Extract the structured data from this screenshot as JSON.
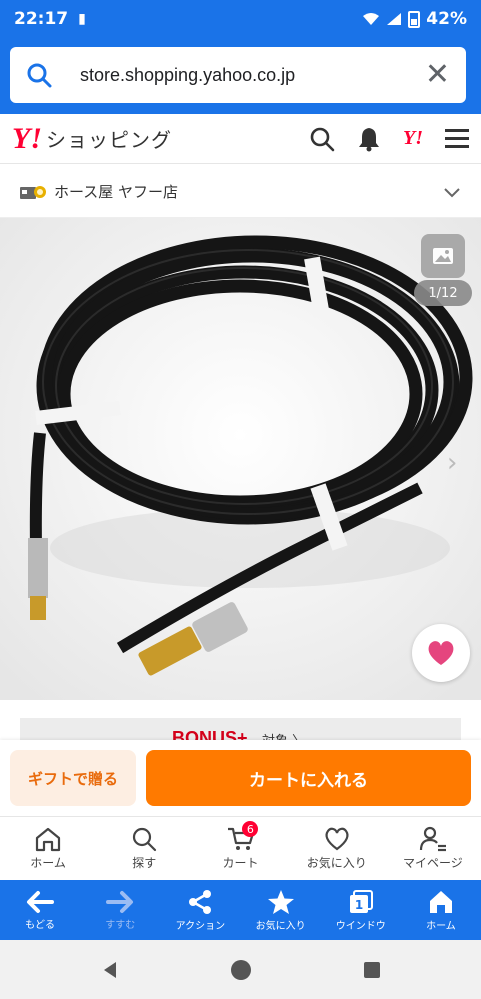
{
  "status": {
    "time": "22:17",
    "battery": "42%"
  },
  "url": {
    "text": "store.shopping.yahoo.co.jp"
  },
  "header": {
    "logo_mark": "Y!",
    "logo_text": "ショッピング",
    "yj_mark": "Y!"
  },
  "store": {
    "name": "ホース屋 ヤフー店"
  },
  "gallery": {
    "counter": "1/12"
  },
  "bonus": {
    "title": "BONUS+",
    "subtitle": "対象 〉"
  },
  "cta": {
    "gift_label": "ギフトで贈る",
    "cart_label": "カートに入れる"
  },
  "tabs": [
    {
      "label": "ホーム",
      "icon": "home-icon"
    },
    {
      "label": "探す",
      "icon": "search-icon"
    },
    {
      "label": "カート",
      "icon": "cart-icon",
      "badge": "6"
    },
    {
      "label": "お気に入り",
      "icon": "heart-icon"
    },
    {
      "label": "マイページ",
      "icon": "person-icon"
    }
  ],
  "browser": [
    {
      "label": "もどる",
      "icon": "back-arrow-icon"
    },
    {
      "label": "すすむ",
      "icon": "forward-arrow-icon"
    },
    {
      "label": "アクション",
      "icon": "share-icon"
    },
    {
      "label": "お気に入り",
      "icon": "star-icon"
    },
    {
      "label": "ウインドウ",
      "icon": "window-icon",
      "count": "1"
    },
    {
      "label": "ホーム",
      "icon": "home-icon"
    }
  ],
  "colors": {
    "brand_blue": "#1a73e8",
    "yahoo_red": "#ff0033",
    "cta_orange": "#ff7a00",
    "heart_pink": "#e5457e"
  }
}
